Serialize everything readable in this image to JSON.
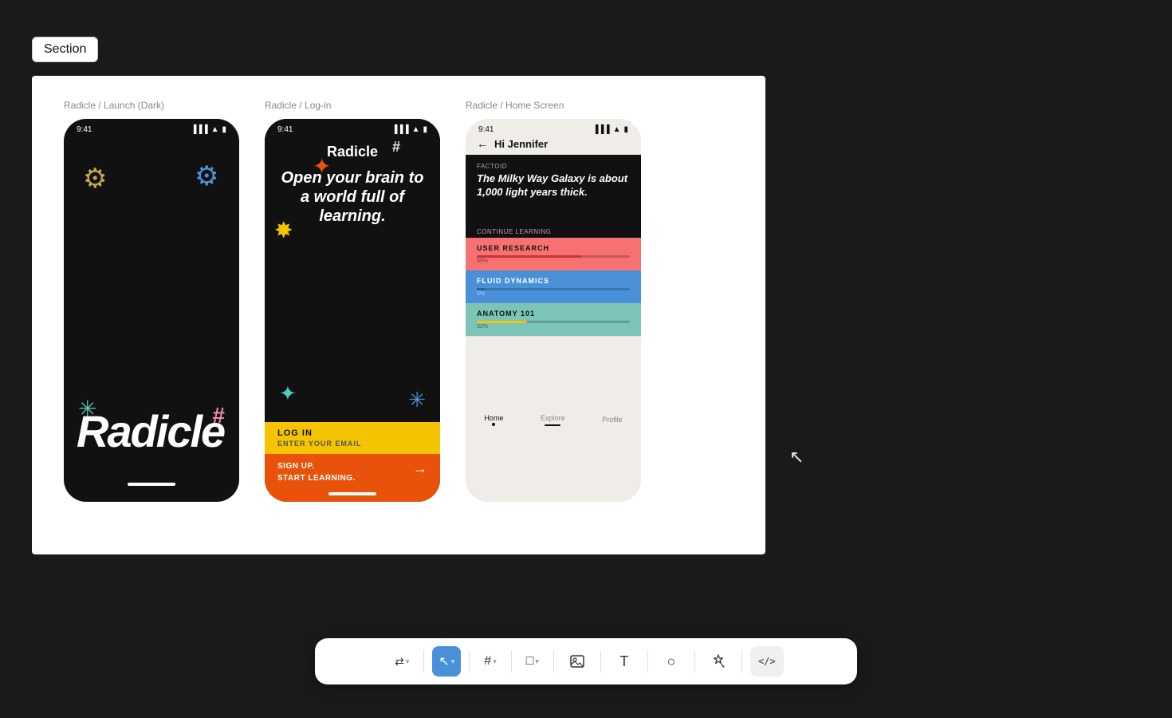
{
  "section_label": "Section",
  "canvas": {
    "phone1": {
      "title": "Radicle / Launch (Dark)",
      "status_time": "9:41",
      "brand_text": "Radicle",
      "bottom_text": ""
    },
    "phone2": {
      "title": "Radicle / Log-in",
      "status_time": "9:41",
      "logo": "Radicle",
      "headline": "Open your brain to a world full of learning.",
      "log_in": "LOG IN",
      "enter_email": "ENTER YOUR EMAIL",
      "sign_up": "SIGN UP.\nSTART LEARNING."
    },
    "phone3": {
      "title": "Radicle / Home Screen",
      "status_time": "9:41",
      "greeting": "Hi Jennifer",
      "factoid_label": "Factoid",
      "factoid_text": "The Milky Way Galaxy is about 1,000 light years thick.",
      "continue_label": "Continue Learning",
      "courses": [
        {
          "name": "USER RESEARCH",
          "color": "pink",
          "progress": 69,
          "progress_label": "69%"
        },
        {
          "name": "FLUID DYNAMICS",
          "color": "blue",
          "progress": 5,
          "progress_label": "5%"
        },
        {
          "name": "ANATOMY 101",
          "color": "teal",
          "progress": 33,
          "progress_label": "33%"
        }
      ],
      "tabs": [
        "Home",
        "Explore",
        "Profile"
      ]
    }
  },
  "toolbar": {
    "tools": [
      {
        "id": "move",
        "icon": "⇄",
        "label": "move tool",
        "active": false,
        "has_chevron": true
      },
      {
        "id": "cursor",
        "icon": "↖",
        "label": "cursor tool",
        "active": true,
        "has_chevron": true
      },
      {
        "id": "frame",
        "icon": "#",
        "label": "frame tool",
        "active": false,
        "has_chevron": true
      },
      {
        "id": "shape",
        "icon": "□",
        "label": "shape tool",
        "active": false,
        "has_chevron": true
      },
      {
        "id": "image",
        "icon": "🖼",
        "label": "image tool",
        "active": false,
        "has_chevron": false
      },
      {
        "id": "text",
        "icon": "T",
        "label": "text tool",
        "active": false,
        "has_chevron": false
      },
      {
        "id": "ellipse",
        "icon": "○",
        "label": "ellipse tool",
        "active": false,
        "has_chevron": false
      },
      {
        "id": "magic",
        "icon": "✦",
        "label": "magic tool",
        "active": false,
        "has_chevron": false
      },
      {
        "id": "code",
        "icon": "</>",
        "label": "code tool",
        "active": false,
        "has_chevron": false
      }
    ]
  }
}
